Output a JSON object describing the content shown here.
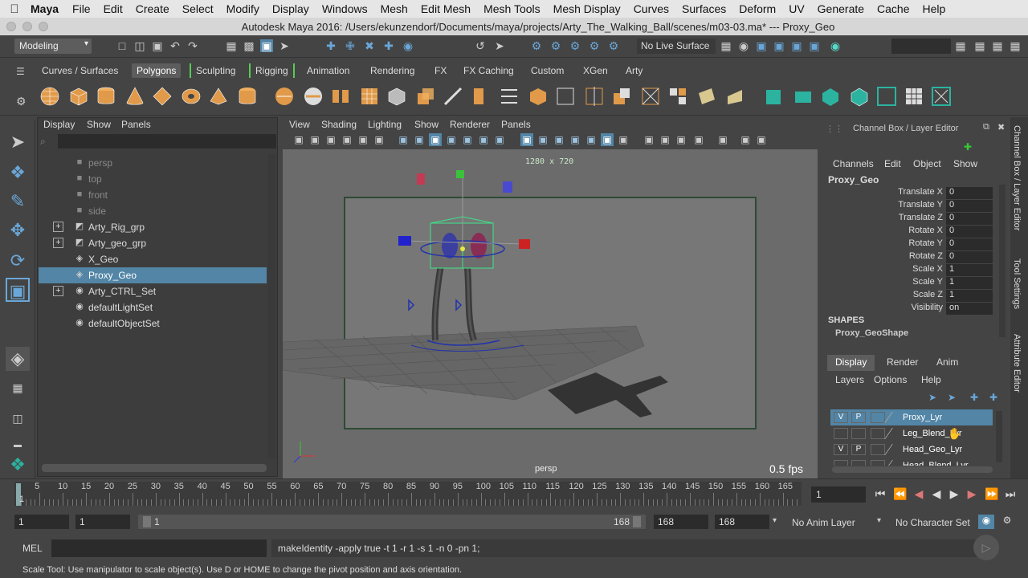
{
  "macmenu": {
    "app": "Maya",
    "items": [
      "File",
      "Edit",
      "Create",
      "Select",
      "Modify",
      "Display",
      "Windows",
      "Mesh",
      "Edit Mesh",
      "Mesh Tools",
      "Mesh Display",
      "Curves",
      "Surfaces",
      "Deform",
      "UV",
      "Generate",
      "Cache",
      "Help"
    ]
  },
  "window": {
    "title": "Autodesk Maya 2016: /Users/ekunzendorf/Documents/maya/projects/Arty_The_Walking_Ball/scenes/m03-03.ma*  ---  Proxy_Geo"
  },
  "status": {
    "menuset": "Modeling",
    "no_live_surface": "No Live Surface"
  },
  "shelf": {
    "tabs": [
      "Curves / Surfaces",
      "Polygons",
      "Sculpting",
      "Rigging",
      "Animation",
      "Rendering",
      "FX",
      "FX Caching",
      "Custom",
      "XGen",
      "Arty"
    ],
    "active": "Polygons"
  },
  "outliner": {
    "menus": [
      "Display",
      "Show",
      "Panels"
    ],
    "items": [
      {
        "label": "persp",
        "icon": "camera-icon",
        "dim": true
      },
      {
        "label": "top",
        "icon": "camera-icon",
        "dim": true
      },
      {
        "label": "front",
        "icon": "camera-icon",
        "dim": true
      },
      {
        "label": "side",
        "icon": "camera-icon",
        "dim": true
      },
      {
        "label": "Arty_Rig_grp",
        "icon": "group-icon",
        "expand": true
      },
      {
        "label": "Arty_geo_grp",
        "icon": "group-icon",
        "expand": true
      },
      {
        "label": "X_Geo",
        "icon": "mesh-icon"
      },
      {
        "label": "Proxy_Geo",
        "icon": "mesh-icon",
        "selected": true
      },
      {
        "label": "Arty_CTRL_Set",
        "icon": "set-icon",
        "expand": true
      },
      {
        "label": "defaultLightSet",
        "icon": "set-icon"
      },
      {
        "label": "defaultObjectSet",
        "icon": "set-icon"
      }
    ]
  },
  "viewport": {
    "menus": [
      "View",
      "Shading",
      "Lighting",
      "Show",
      "Renderer",
      "Panels"
    ],
    "resolution": "1280 x 720",
    "camera": "persp",
    "fps": "0.5 fps"
  },
  "channelbox": {
    "title": "Channel Box / Layer Editor",
    "menus": [
      "Channels",
      "Edit",
      "Object",
      "Show"
    ],
    "object": "Proxy_Geo",
    "attrs": [
      {
        "name": "Translate X",
        "value": "0"
      },
      {
        "name": "Translate Y",
        "value": "0"
      },
      {
        "name": "Translate Z",
        "value": "0"
      },
      {
        "name": "Rotate X",
        "value": "0"
      },
      {
        "name": "Rotate Y",
        "value": "0"
      },
      {
        "name": "Rotate Z",
        "value": "0"
      },
      {
        "name": "Scale X",
        "value": "1"
      },
      {
        "name": "Scale Y",
        "value": "1"
      },
      {
        "name": "Scale Z",
        "value": "1"
      },
      {
        "name": "Visibility",
        "value": "on"
      }
    ],
    "shapes_label": "SHAPES",
    "shape": "Proxy_GeoShape"
  },
  "layers": {
    "tabs": [
      "Display",
      "Render",
      "Anim"
    ],
    "menus": [
      "Layers",
      "Options",
      "Help"
    ],
    "rows": [
      {
        "v": "V",
        "p": "P",
        "name": "Proxy_Lyr",
        "selected": true
      },
      {
        "v": "",
        "p": "",
        "name": "Leg_Blend_Lyr"
      },
      {
        "v": "V",
        "p": "P",
        "name": "Head_Geo_Lyr"
      },
      {
        "v": "",
        "p": "",
        "name": "Head_Blend_Lyr"
      }
    ]
  },
  "side_tabs": [
    "Channel Box / Layer Editor",
    "Tool Settings",
    "Attribute Editor"
  ],
  "timeline": {
    "ticks": [
      "5",
      "10",
      "15",
      "20",
      "25",
      "30",
      "35",
      "40",
      "45",
      "50",
      "55",
      "60",
      "65",
      "70",
      "75",
      "80",
      "85",
      "90",
      "95",
      "100",
      "105",
      "110",
      "115",
      "120",
      "125",
      "130",
      "135",
      "140",
      "145",
      "150",
      "155",
      "160",
      "165"
    ],
    "start": "1",
    "current": "1"
  },
  "range": {
    "start": "1",
    "playback_start": "1",
    "slider_start": "1",
    "slider_end": "168",
    "playback_end": "168",
    "end": "168",
    "anim_layer": "No Anim Layer",
    "char_set": "No Character Set"
  },
  "command": {
    "label": "MEL",
    "text": "makeIdentity -apply true -t 1 -r 1 -s 1 -n 0 -pn 1;"
  },
  "help": "Scale Tool: Use manipulator to scale object(s). Use D or HOME to change the pivot position and axis orientation."
}
